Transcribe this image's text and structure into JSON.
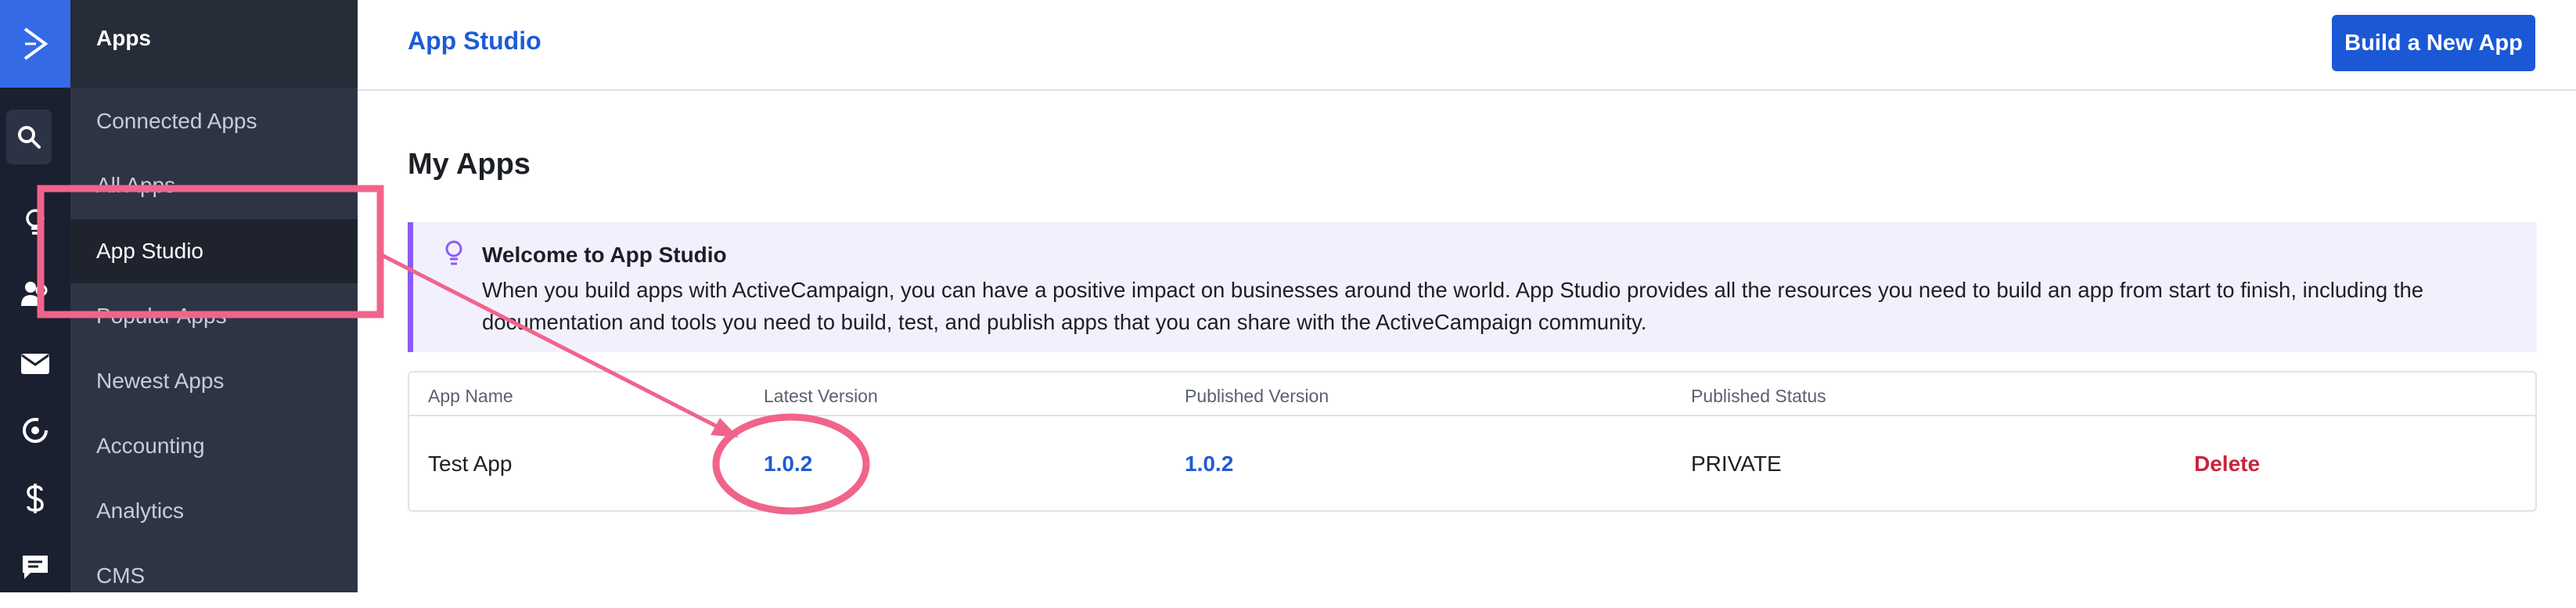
{
  "rail": {
    "icons": [
      "activecampaign-logo-icon",
      "search-icon",
      "lightbulb-icon",
      "contacts-icon",
      "email-icon",
      "automation-icon",
      "dollar-icon",
      "chat-icon"
    ]
  },
  "sidebar": {
    "title": "Apps",
    "items": [
      {
        "label": "Connected Apps"
      },
      {
        "label": "All Apps"
      },
      {
        "label": "App Studio"
      },
      {
        "label": "Popular Apps"
      },
      {
        "label": "Newest Apps"
      },
      {
        "label": "Accounting"
      },
      {
        "label": "Analytics"
      },
      {
        "label": "CMS"
      }
    ]
  },
  "header": {
    "breadcrumb": "App Studio",
    "build_button": "Build a New App"
  },
  "main": {
    "title": "My Apps",
    "banner": {
      "title": "Welcome to App Studio",
      "text": "When you build apps with ActiveCampaign, you can have a positive impact on businesses around the world. App Studio provides all the resources you need to build an app from start to finish, including the documentation and tools you need to build, test, and publish apps that you can share with the ActiveCampaign community."
    },
    "table": {
      "headers": [
        "App Name",
        "Latest Version",
        "Published Version",
        "Published Status"
      ],
      "rows": [
        {
          "app_name": "Test App",
          "latest_version": "1.0.2",
          "published_version": "1.0.2",
          "status": "PRIVATE",
          "action": "Delete"
        }
      ]
    }
  },
  "colors": {
    "accent": "#1b58d6",
    "annotation": "#f0648c",
    "banner_border": "#8b5cf6",
    "danger": "#c8243c"
  }
}
